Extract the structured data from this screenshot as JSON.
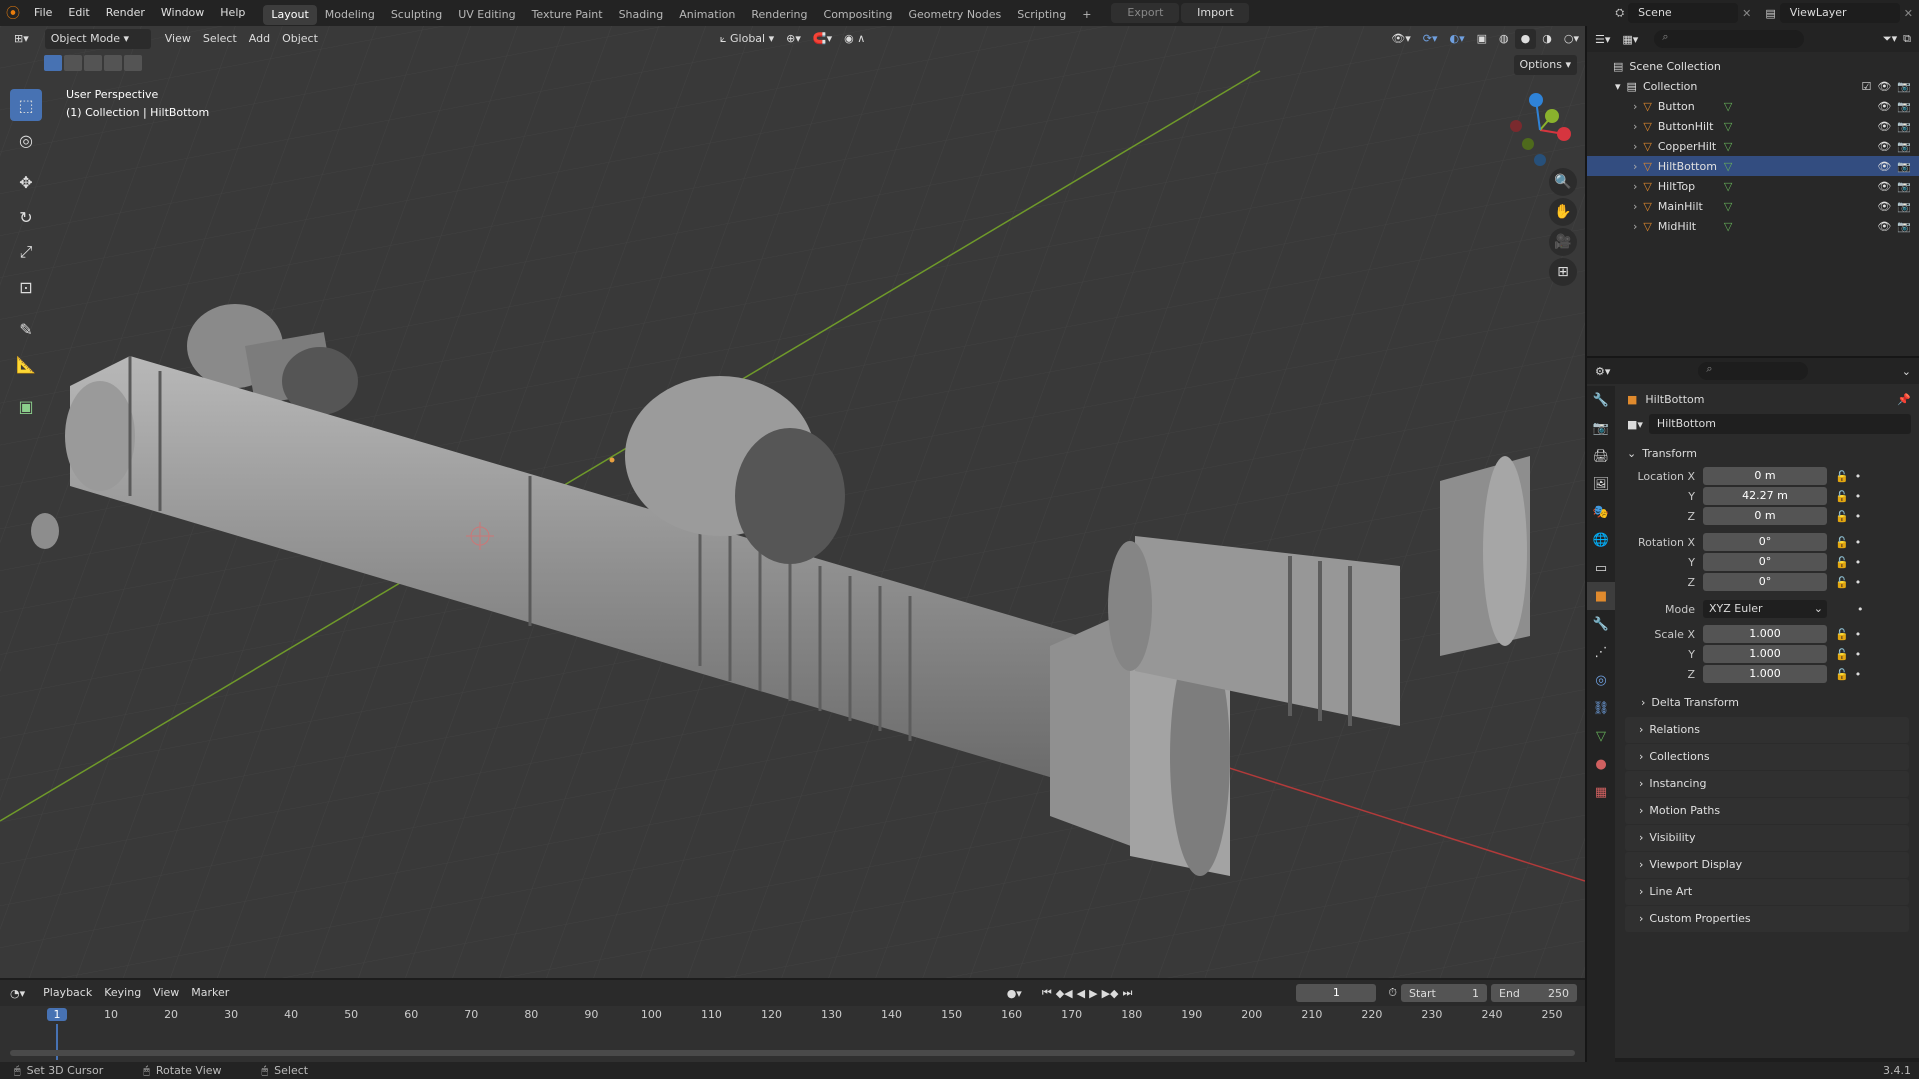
{
  "topbar": {
    "menus": [
      "File",
      "Edit",
      "Render",
      "Window",
      "Help"
    ],
    "workspaces": [
      "Layout",
      "Modeling",
      "Sculpting",
      "UV Editing",
      "Texture Paint",
      "Shading",
      "Animation",
      "Rendering",
      "Compositing",
      "Geometry Nodes",
      "Scripting"
    ],
    "active_workspace": "Layout",
    "add_tab": "+",
    "export_label": "Export",
    "import_label": "Import",
    "scene_name": "Scene",
    "view_layer": "ViewLayer"
  },
  "viewport": {
    "mode": "Object Mode",
    "menus": [
      "View",
      "Select",
      "Add",
      "Object"
    ],
    "orientation": "Global",
    "options_label": "Options",
    "perspective": "User Perspective",
    "context": "(1) Collection | HiltBottom",
    "tools": [
      "select-box",
      "cursor",
      "move",
      "rotate",
      "scale",
      "transform",
      "annotate",
      "measure",
      "add-cube"
    ],
    "gizmo_axes": [
      "X",
      "Y",
      "Z"
    ]
  },
  "outliner": {
    "scene_collection": "Scene Collection",
    "collection": "Collection",
    "objects": [
      "Button",
      "ButtonHilt",
      "CopperHilt",
      "HiltBottom",
      "HiltTop",
      "MainHilt",
      "MidHilt"
    ],
    "selected": "HiltBottom"
  },
  "properties": {
    "object_name": "HiltBottom",
    "object_field": "HiltBottom",
    "transform_label": "Transform",
    "location": {
      "label_x": "Location X",
      "label_y": "Y",
      "label_z": "Z",
      "x": "0 m",
      "y": "42.27 m",
      "z": "0 m"
    },
    "rotation": {
      "label_x": "Rotation X",
      "label_y": "Y",
      "label_z": "Z",
      "x": "0°",
      "y": "0°",
      "z": "0°"
    },
    "mode_label": "Mode",
    "mode_value": "XYZ Euler",
    "scale": {
      "label_x": "Scale X",
      "label_y": "Y",
      "label_z": "Z",
      "x": "1.000",
      "y": "1.000",
      "z": "1.000"
    },
    "delta_transform": "Delta Transform",
    "panels": [
      "Relations",
      "Collections",
      "Instancing",
      "Motion Paths",
      "Visibility",
      "Viewport Display",
      "Line Art",
      "Custom Properties"
    ]
  },
  "timeline": {
    "menus": [
      "Playback",
      "Keying",
      "View",
      "Marker"
    ],
    "current_frame": "1",
    "start_label": "Start",
    "start": "1",
    "end_label": "End",
    "end": "250",
    "ticks": [
      "1",
      "10",
      "20",
      "30",
      "40",
      "50",
      "60",
      "70",
      "80",
      "90",
      "100",
      "110",
      "120",
      "130",
      "140",
      "150",
      "160",
      "170",
      "180",
      "190",
      "200",
      "210",
      "220",
      "230",
      "240",
      "250"
    ]
  },
  "statusbar": {
    "hints": [
      "Set 3D Cursor",
      "Rotate View",
      "Select"
    ],
    "version": "3.4.1"
  },
  "colors": {
    "accent": "#4772b3",
    "x_axis": "#d6353f",
    "y_axis": "#8ab22d",
    "z_axis": "#2f83d8",
    "object_orange": "#e08a2d",
    "mesh_green": "#66b05a"
  }
}
